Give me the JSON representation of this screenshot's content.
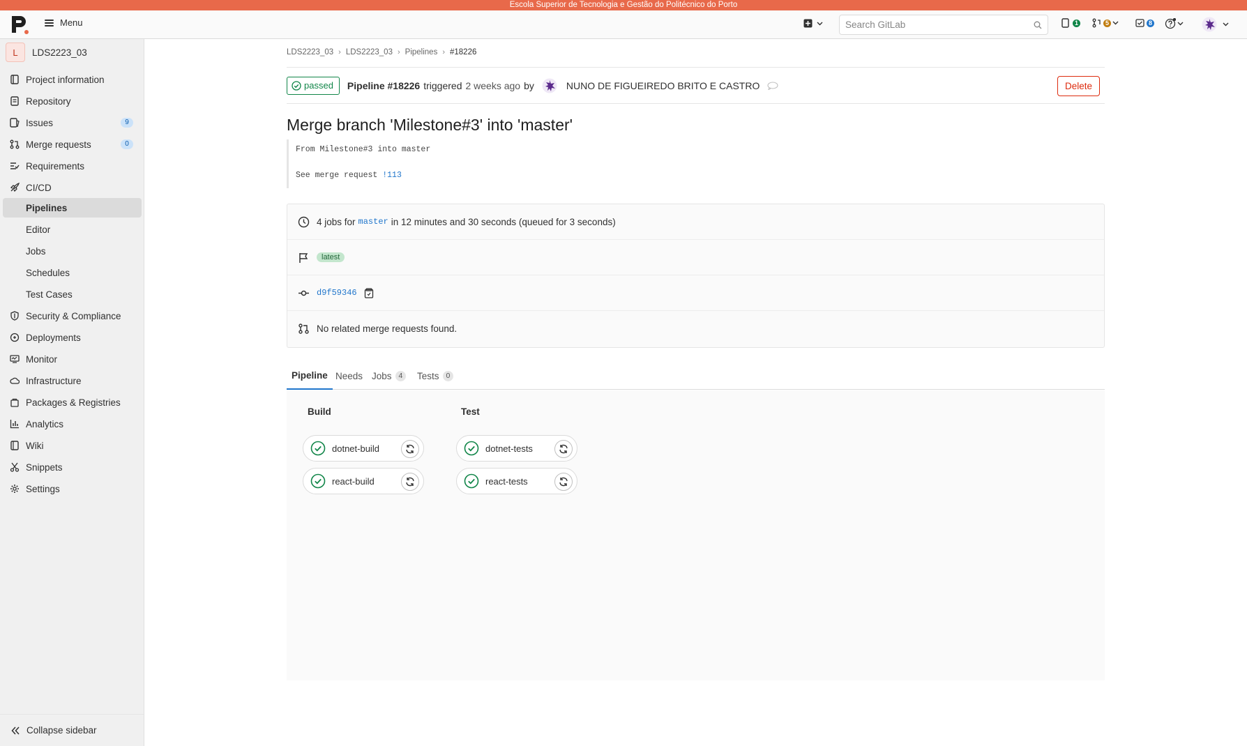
{
  "banner": "Escola Superior de Tecnologia e Gestão do Politécnico do Porto",
  "header": {
    "menu_label": "Menu",
    "search_placeholder": "Search GitLab",
    "issues_count": "1",
    "mr_count": "5",
    "todos_count": "8"
  },
  "sidebar": {
    "project_initial": "L",
    "project_name": "LDS2223_03",
    "items": [
      {
        "label": "Project information",
        "icon": "project-icon"
      },
      {
        "label": "Repository",
        "icon": "doc-icon"
      },
      {
        "label": "Issues",
        "icon": "issues-icon",
        "badge": "9"
      },
      {
        "label": "Merge requests",
        "icon": "merge-request-icon",
        "badge": "0"
      },
      {
        "label": "Requirements",
        "icon": "requirements-icon"
      },
      {
        "label": "CI/CD",
        "icon": "rocket-icon"
      },
      {
        "label": "Pipelines"
      },
      {
        "label": "Editor"
      },
      {
        "label": "Jobs"
      },
      {
        "label": "Schedules"
      },
      {
        "label": "Test Cases"
      },
      {
        "label": "Security & Compliance",
        "icon": "shield-icon"
      },
      {
        "label": "Deployments",
        "icon": "deployments-icon"
      },
      {
        "label": "Monitor",
        "icon": "monitor-icon"
      },
      {
        "label": "Infrastructure",
        "icon": "cloud-icon"
      },
      {
        "label": "Packages & Registries",
        "icon": "package-icon"
      },
      {
        "label": "Analytics",
        "icon": "chart-icon"
      },
      {
        "label": "Wiki",
        "icon": "book-icon"
      },
      {
        "label": "Snippets",
        "icon": "scissors-icon"
      },
      {
        "label": "Settings",
        "icon": "gear-icon"
      }
    ],
    "collapse_label": "Collapse sidebar"
  },
  "breadcrumbs": [
    "LDS2223_03",
    "LDS2223_03",
    "Pipelines",
    "#18226"
  ],
  "pipeline": {
    "status": "passed",
    "name": "Pipeline #18226",
    "triggered_text": "triggered",
    "time_ago": "2 weeks ago",
    "by_text": "by",
    "author": "NUNO DE FIGUEIREDO BRITO E CASTRO",
    "delete_label": "Delete",
    "title": "Merge branch 'Milestone#3' into 'master'",
    "desc_line1": "From Milestone#3 into master",
    "desc_line2_prefix": "See merge request ",
    "desc_line2_link": "!113",
    "jobs_prefix": "4 jobs for",
    "branch": "master",
    "jobs_suffix": "in 12 minutes and 30 seconds (queued for 3 seconds)",
    "tag": "latest",
    "commit_sha": "d9f59346",
    "mr_text": "No related merge requests found."
  },
  "tabs": [
    {
      "label": "Pipeline"
    },
    {
      "label": "Needs"
    },
    {
      "label": "Jobs",
      "count": "4"
    },
    {
      "label": "Tests",
      "count": "0"
    }
  ],
  "stages": [
    {
      "name": "Build",
      "jobs": [
        "dotnet-build",
        "react-build"
      ]
    },
    {
      "name": "Test",
      "jobs": [
        "dotnet-tests",
        "react-tests"
      ]
    }
  ],
  "colors": {
    "banner": "#e8694a",
    "success": "#108548",
    "danger": "#dd2b0e",
    "link": "#1f75cb"
  }
}
